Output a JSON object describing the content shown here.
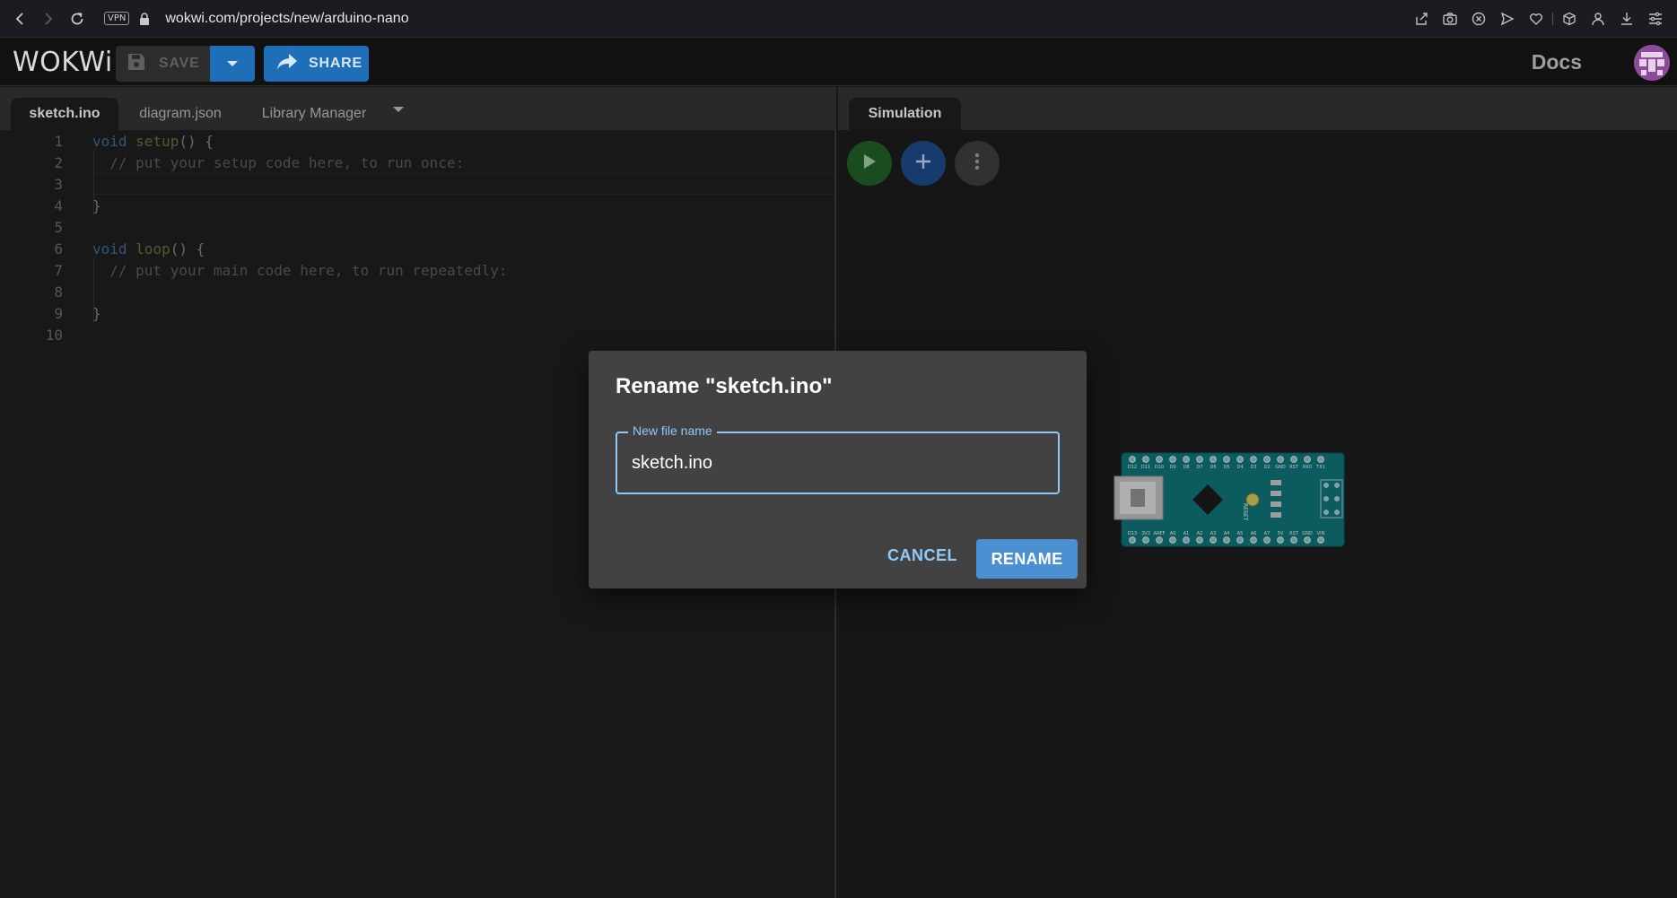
{
  "browser": {
    "vpn_label": "VPN",
    "url_host": "wokwi.com",
    "url_path": "/projects/new/arduino-nano"
  },
  "header": {
    "logo_text": "WOKWi",
    "save_label": "SAVE",
    "share_label": "SHARE",
    "docs_label": "Docs"
  },
  "editor": {
    "tabs": [
      {
        "label": "sketch.ino",
        "active": true
      },
      {
        "label": "diagram.json",
        "active": false
      },
      {
        "label": "Library Manager",
        "active": false
      }
    ],
    "lines": [
      {
        "n": "1",
        "text": "void setup() {"
      },
      {
        "n": "2",
        "text": "  // put your setup code here, to run once:"
      },
      {
        "n": "3",
        "text": ""
      },
      {
        "n": "4",
        "text": "}"
      },
      {
        "n": "5",
        "text": ""
      },
      {
        "n": "6",
        "text": "void loop() {"
      },
      {
        "n": "7",
        "text": "  // put your main code here, to run repeatedly:"
      },
      {
        "n": "8",
        "text": ""
      },
      {
        "n": "9",
        "text": "}"
      },
      {
        "n": "10",
        "text": ""
      }
    ]
  },
  "simulation": {
    "tab_label": "Simulation",
    "board": {
      "name": "Arduino Nano",
      "top_pins": [
        "D12",
        "D11",
        "D10",
        "D9",
        "D8",
        "D7",
        "D6",
        "D5",
        "D4",
        "D3",
        "D2",
        "GND",
        "RST",
        "RX0",
        "TX1"
      ],
      "bottom_pins": [
        "D13",
        "3V3",
        "AREF",
        "A0",
        "A1",
        "A2",
        "A3",
        "A4",
        "A5",
        "A6",
        "A7",
        "5V",
        "RST",
        "GND",
        "VIN"
      ],
      "reset_label": "RESET",
      "led_labels": [
        "TX",
        "RX",
        "L",
        "ON"
      ]
    }
  },
  "dialog": {
    "title": "Rename \"sketch.ino\"",
    "field_label": "New file name",
    "field_value": "sketch.ino",
    "cancel_label": "CANCEL",
    "rename_label": "RENAME"
  },
  "colors": {
    "accent": "#1f6fb8",
    "dialog_accent": "#90caf9",
    "rename_button": "#4a90d2",
    "board_teal": "#0f6f74"
  }
}
